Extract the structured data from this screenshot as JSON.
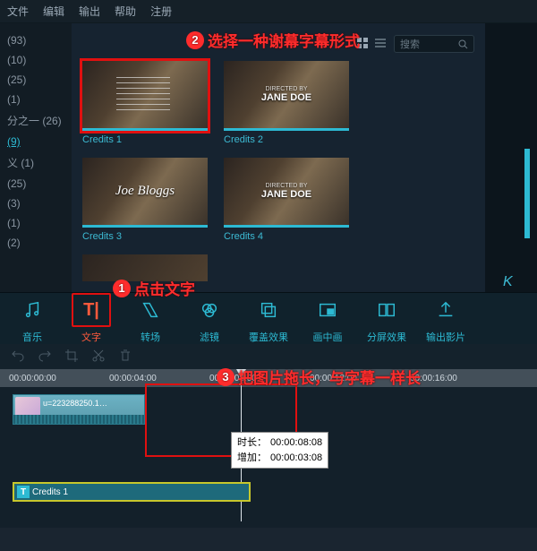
{
  "menu": {
    "file": "文件",
    "edit": "编辑",
    "output": "输出",
    "help": "帮助",
    "register": "注册"
  },
  "side": {
    "i0": "(93)",
    "i1": "(10)",
    "i2": "(25)",
    "i3": "(1)",
    "i4": "分之一 (26)",
    "i5": "(9)",
    "i6": "义 (1)",
    "i7": "(25)",
    "i8": "(3)",
    "i9": "(1)",
    "i10": "(2)"
  },
  "search": {
    "placeholder": "搜索"
  },
  "thumbs": {
    "c1": "Credits 1",
    "c2": "Credits 2",
    "c3": "Credits 3",
    "c4": "Credits 4",
    "t2": "JANE DOE",
    "t3": "Joe Bloggs",
    "t4": "JANE DOE",
    "t2sub": "DIRECTED BY",
    "t4sub": "DIRECTED BY"
  },
  "annot": {
    "a1_num": "1",
    "a1_txt": "点击文字",
    "a2_num": "2",
    "a2_txt": "选择一种谢幕字幕形式",
    "a3_num": "3",
    "a3_txt": "把图片拖长，与字幕一样长"
  },
  "tools": {
    "music": "音乐",
    "text": "文字",
    "trans": "转场",
    "filter": "滤镜",
    "overlay": "覆盖效果",
    "pip": "画中画",
    "split": "分屏效果",
    "export": "输出影片",
    "ticon": "T|"
  },
  "ruler": {
    "t0": "00:00:00:00",
    "t1": "00:00:04:00",
    "t2": "00:00:08:00",
    "t3": "00:00:12:00",
    "t4": "00:00:16:00"
  },
  "clipA": {
    "name": "u=223288250.1…"
  },
  "info": {
    "dur_lbl": "时长：",
    "dur_val": "00:00:08:08",
    "add_lbl": "增加：",
    "add_val": "00:00:03:08"
  },
  "clipT": {
    "label": "Credits 1",
    "icon": "T"
  },
  "preview": {
    "letter": "K"
  }
}
